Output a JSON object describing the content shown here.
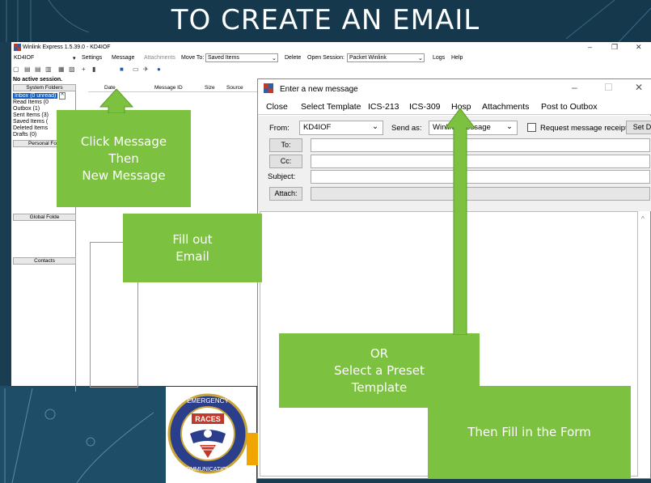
{
  "banner": {
    "title": "TO CREATE AN EMAIL"
  },
  "app": {
    "title": "Winlink Express 1.5.39.0 - KD4IOF",
    "callsign": "KD4IOF",
    "menu": {
      "settings": "Settings",
      "message": "Message",
      "attachments": "Attachments",
      "move_to": "Move To:",
      "move_to_value": "Saved Items",
      "delete": "Delete",
      "open_session": "Open Session:",
      "session_value": "Packet Winlink",
      "logs": "Logs",
      "help": "Help"
    },
    "status": "No active session.",
    "system_folders_header": "System Folders",
    "folders": [
      "Inbox (0 unread)",
      "Read Items (0",
      "Outbox (1)",
      "Sent Items (3)",
      "Saved Items (",
      "Deleted Items",
      "Drafts (0)"
    ],
    "personal_folders_header": "Personal Fold",
    "global_folders_header": "Global Folde",
    "contacts_header": "Contacts",
    "columns": {
      "date": "Date",
      "message_id": "Message ID",
      "size": "Size",
      "source": "Source"
    }
  },
  "compose": {
    "title": "Enter a new message",
    "menu": [
      "Close",
      "Select Template",
      "ICS-213",
      "ICS-309",
      "Hosp",
      "Attachments",
      "Post to Outbox"
    ],
    "from_label": "From:",
    "from_value": "KD4IOF",
    "send_as_label": "Send as:",
    "send_as_value": "Winlink Message",
    "request_receipt_label": "Request message receipt",
    "set_label": "Set D",
    "to_label": "To:",
    "cc_label": "Cc:",
    "subject_label": "Subject:",
    "attach_label": "Attach:"
  },
  "callouts": {
    "click_message": [
      "Click Message",
      "Then",
      "New Message"
    ],
    "fill_out": [
      "Fill out",
      "Email"
    ],
    "preset": [
      "OR",
      "Select a Preset",
      "Template"
    ],
    "fill_form": "Then Fill in the Form"
  },
  "logo": {
    "top_text": "EMERGENCY",
    "mid_text": "RACES",
    "bottom_text": "COMMUNICATIONS"
  },
  "colors": {
    "banner": "#15384d",
    "callout": "#7cc140",
    "selection": "#0b5fc6"
  }
}
